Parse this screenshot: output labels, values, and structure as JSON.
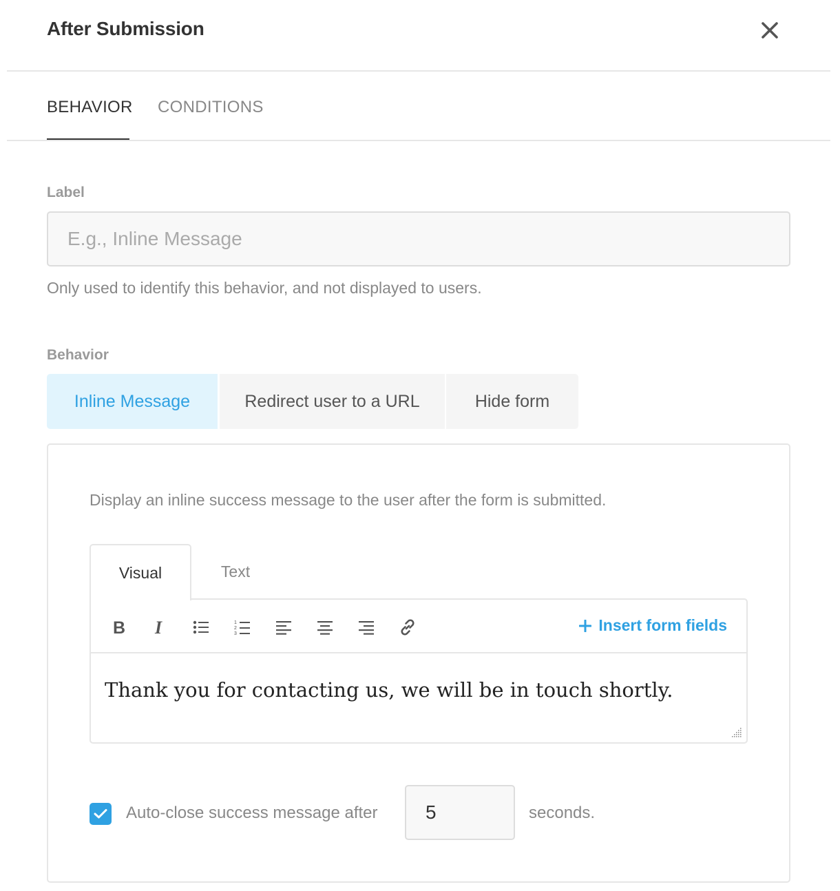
{
  "dialog": {
    "title": "After Submission",
    "close_icon": "close-icon"
  },
  "tabs": [
    {
      "label": "BEHAVIOR",
      "active": true
    },
    {
      "label": "CONDITIONS",
      "active": false
    }
  ],
  "label_field": {
    "label": "Label",
    "value": "",
    "placeholder": "E.g., Inline Message",
    "help": "Only used to identify this behavior, and not displayed to users."
  },
  "behavior": {
    "label": "Behavior",
    "options": [
      {
        "label": "Inline Message",
        "selected": true
      },
      {
        "label": "Redirect user to a URL",
        "selected": false
      },
      {
        "label": "Hide form",
        "selected": false
      }
    ]
  },
  "inline_message": {
    "description": "Display an inline success message to the user after the form is submitted.",
    "editor_tabs": [
      {
        "label": "Visual",
        "active": true
      },
      {
        "label": "Text",
        "active": false
      }
    ],
    "toolbar": {
      "icons": [
        "bold-icon",
        "italic-icon",
        "bullet-list-icon",
        "numbered-list-icon",
        "align-left-icon",
        "align-center-icon",
        "align-right-icon",
        "link-icon"
      ],
      "insert_fields_label": "Insert form fields"
    },
    "content": "Thank you for contacting us, we will be in touch shortly."
  },
  "auto_close": {
    "checked": true,
    "label": "Auto-close success message after",
    "value": "5",
    "suffix": "seconds."
  },
  "colors": {
    "accent": "#2fa1e2",
    "accent_bg": "#e1f4fd",
    "text": "#333333",
    "muted": "#888888",
    "border": "#e6e6e6"
  }
}
